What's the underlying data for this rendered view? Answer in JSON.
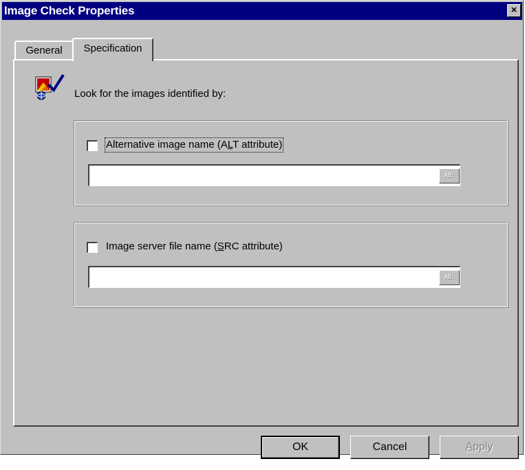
{
  "window": {
    "title": "Image Check Properties",
    "close_label": "×"
  },
  "tabs": [
    {
      "label": "General",
      "active": false
    },
    {
      "label": "Specification",
      "active": true
    }
  ],
  "spec": {
    "icon": "image-check-icon",
    "instruction": "Look for the images identified by:",
    "alt_group": {
      "label_pre": "Alternative image name (A",
      "label_mnemonic": "L",
      "label_post": "T attribute)",
      "checked": false,
      "value": "",
      "button_label": "AB:"
    },
    "src_group": {
      "label_pre": "Image server file name (",
      "label_mnemonic": "S",
      "label_post": "RC attribute)",
      "checked": false,
      "value": "",
      "button_label": "AB:"
    }
  },
  "buttons": {
    "ok": "OK",
    "cancel": "Cancel",
    "apply_mnemonic": "A",
    "apply_rest": "pply"
  },
  "colors": {
    "titlebar": "#000080",
    "face": "#c0c0c0"
  }
}
